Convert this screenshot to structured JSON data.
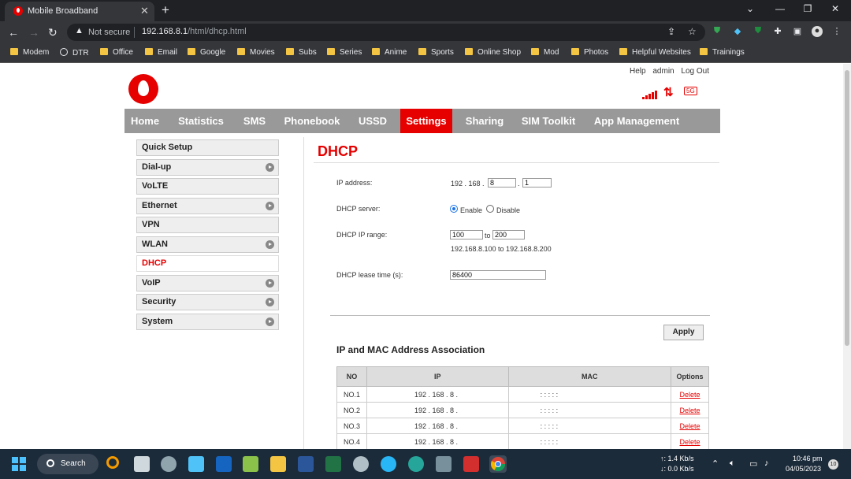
{
  "browser": {
    "tab_title": "Mobile Broadband",
    "not_secure": "Not secure",
    "host": "192.168.8.1",
    "path": "/html/dhcp.html",
    "bookmarks": [
      "Modem",
      "DTR",
      "Office",
      "Email",
      "Google",
      "Movies",
      "Subs",
      "Series",
      "Anime",
      "Sports",
      "Online Shop",
      "Mod",
      "Photos",
      "Helpful Websites",
      "Trainings"
    ]
  },
  "header": {
    "links": [
      "Help",
      "admin",
      "Log Out"
    ],
    "network_badge": "5G"
  },
  "menu": [
    "Home",
    "Statistics",
    "SMS",
    "Phonebook",
    "USSD",
    "Settings",
    "Sharing",
    "SIM Toolkit",
    "App Management"
  ],
  "sidebar": [
    "Quick Setup",
    "Dial-up",
    "VoLTE",
    "Ethernet",
    "VPN",
    "WLAN",
    "DHCP",
    "VoIP",
    "Security",
    "System"
  ],
  "form": {
    "title": "DHCP",
    "ip_label": "IP address:",
    "ip_prefix": "192 . 168 .",
    "ip_octet3": "8",
    "ip_dot": ".",
    "ip_octet4": "1",
    "server_label": "DHCP server:",
    "enable": "Enable",
    "disable": "Disable",
    "range_label": "DHCP IP range:",
    "range_start": "100",
    "range_to": "to",
    "range_end": "200",
    "range_text": "192.168.8.100 to 192.168.8.200",
    "lease_label": "DHCP lease time (s):",
    "lease_value": "86400",
    "apply": "Apply"
  },
  "assoc": {
    "title": "IP and MAC Address Association",
    "headers": [
      "NO",
      "IP",
      "MAC",
      "Options"
    ],
    "rows": [
      {
        "no": "NO.1",
        "ip": "192 . 168 . 8 .",
        "mac": ":    :    :    :    :",
        "opt": "Delete"
      },
      {
        "no": "NO.2",
        "ip": "192 . 168 . 8 .",
        "mac": ":    :    :    :    :",
        "opt": "Delete"
      },
      {
        "no": "NO.3",
        "ip": "192 . 168 . 8 .",
        "mac": ":    :    :    :    :",
        "opt": "Delete"
      },
      {
        "no": "NO.4",
        "ip": "192 . 168 . 8 .",
        "mac": ":    :    :    :    :",
        "opt": "Delete"
      }
    ]
  },
  "taskbar": {
    "search": "Search",
    "up_speed": "↑: 1.4 Kb/s",
    "down_speed": "↓: 0.0 Kb/s",
    "time": "10:46 pm",
    "date": "04/05/2023",
    "notifications": "10"
  },
  "colors": {
    "brand": "#e60000"
  }
}
